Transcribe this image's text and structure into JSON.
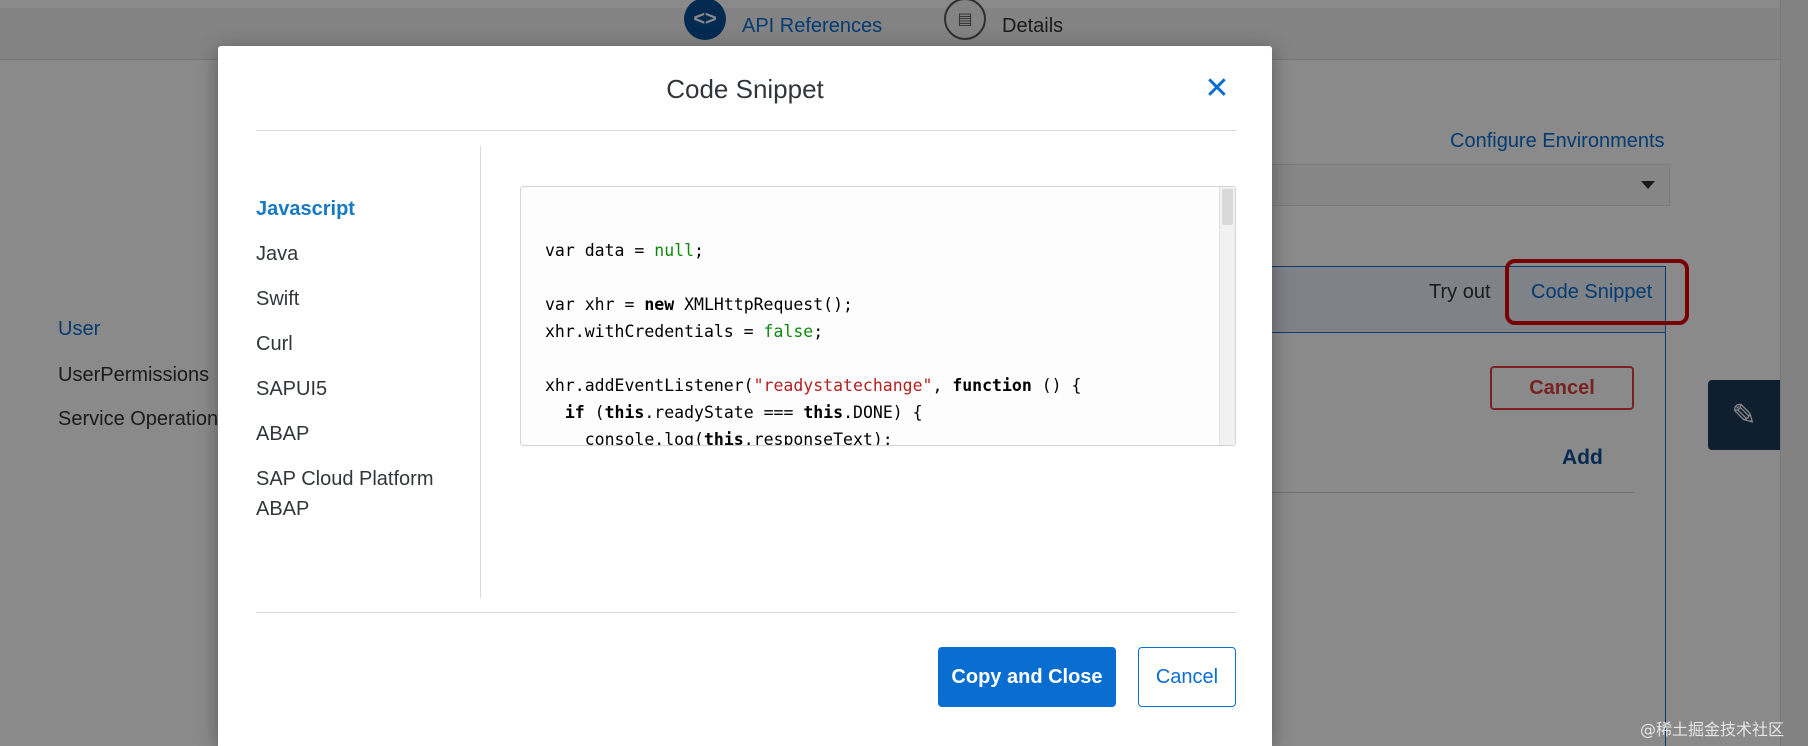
{
  "header": {
    "nav": [
      {
        "label": "API References",
        "icon": "code-icon"
      },
      {
        "label": "Details",
        "icon": "list-icon"
      }
    ]
  },
  "background": {
    "configure_link": "Configure Environments",
    "tabs": {
      "try_out": "Try out",
      "code_snippet": "Code Snippet"
    },
    "cancel_label": "Cancel",
    "add_label": "Add",
    "left_nav": [
      "User",
      "UserPermissions",
      "Service Operation"
    ]
  },
  "dialog": {
    "title": "Code Snippet",
    "close_icon": "close-icon",
    "languages": [
      {
        "label": "Javascript",
        "active": true
      },
      {
        "label": "Java",
        "active": false
      },
      {
        "label": "Swift",
        "active": false
      },
      {
        "label": "Curl",
        "active": false
      },
      {
        "label": "SAPUI5",
        "active": false
      },
      {
        "label": "ABAP",
        "active": false
      },
      {
        "label": "SAP Cloud Platform ABAP",
        "active": false
      }
    ],
    "code_lines": [
      "var data = null;",
      "",
      "var xhr = new XMLHttpRequest();",
      "xhr.withCredentials = false;",
      "",
      "xhr.addEventListener(\"readystatechange\", function () {",
      "  if (this.readyState === this.DONE) {",
      "    console.log(this.responseText);"
    ],
    "copy_close_label": "Copy and Close",
    "cancel_label": "Cancel"
  },
  "watermark": "@稀土掘金技术社区",
  "colors": {
    "accent": "#0a6ed1",
    "danger": "#e00000",
    "string": "#b52020",
    "literal": "#0f8a0f"
  }
}
